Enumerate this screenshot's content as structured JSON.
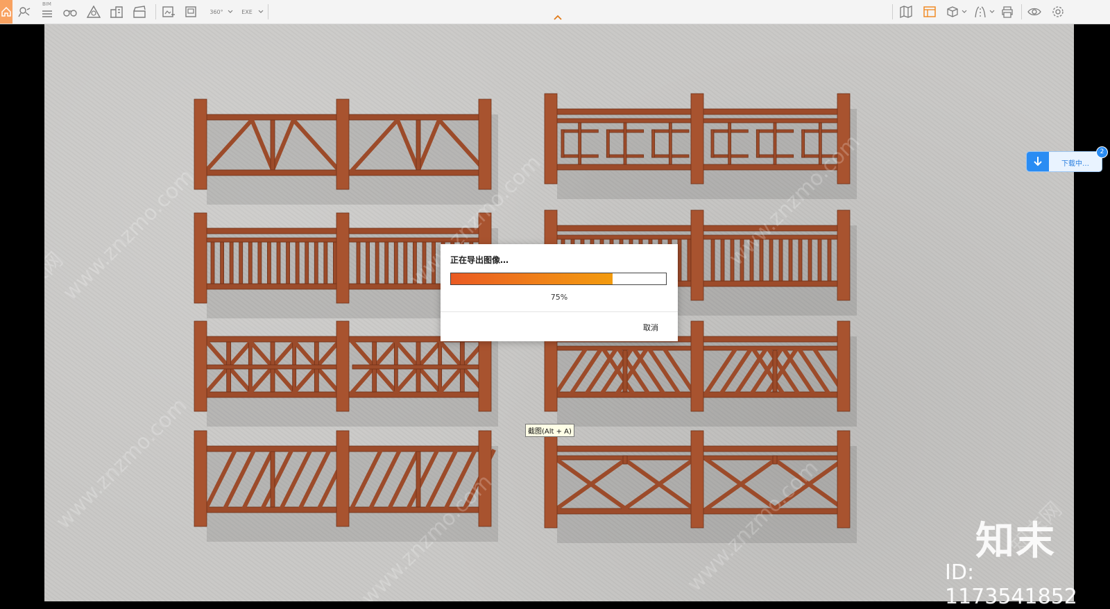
{
  "toolbar": {
    "bim_label": "BIM",
    "left_icons": [
      "home-icon",
      "location-pin-icon",
      "bim-list-icon",
      "binoculars-icon",
      "triangle-scale-icon",
      "buildings-icon",
      "clapperboard-icon",
      "image-export-icon",
      "image-export-alt-icon",
      "panorama-360-icon",
      "exe-export-icon"
    ],
    "right_icons": [
      "map-book-icon",
      "layout-grid-icon",
      "box-3d-icon",
      "road-path-icon",
      "printer-icon",
      "eye-icon",
      "gear-icon"
    ],
    "panorama_label": "360°",
    "exe_label": "EXE"
  },
  "dialog": {
    "title": "正在导出图像…",
    "progress_percent": 75,
    "progress_label": "75%",
    "cancel_label": "取消"
  },
  "tooltip": {
    "text": "截图(Alt + A)"
  },
  "download": {
    "label": "下载中…",
    "badge": "2"
  },
  "watermark": {
    "site": "www.znzmo.com",
    "cn": "知末网",
    "logo": "知末",
    "id": "ID: 1173541852"
  },
  "colors": {
    "accent_orange": "#f08418",
    "progress_start": "#ea5a23",
    "download_blue": "#2a8cf3",
    "wood": "#9c4b2a"
  }
}
